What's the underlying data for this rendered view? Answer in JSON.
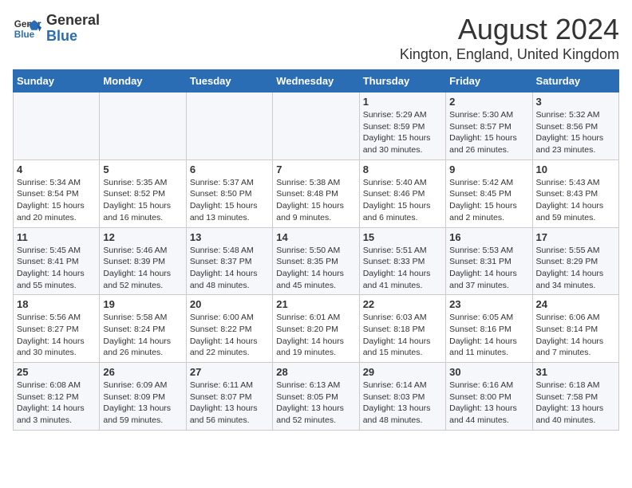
{
  "header": {
    "logo_line1": "General",
    "logo_line2": "Blue",
    "title": "August 2024",
    "subtitle": "Kington, England, United Kingdom"
  },
  "weekdays": [
    "Sunday",
    "Monday",
    "Tuesday",
    "Wednesday",
    "Thursday",
    "Friday",
    "Saturday"
  ],
  "weeks": [
    [
      {
        "day": "",
        "info": ""
      },
      {
        "day": "",
        "info": ""
      },
      {
        "day": "",
        "info": ""
      },
      {
        "day": "",
        "info": ""
      },
      {
        "day": "1",
        "info": "Sunrise: 5:29 AM\nSunset: 8:59 PM\nDaylight: 15 hours and 30 minutes."
      },
      {
        "day": "2",
        "info": "Sunrise: 5:30 AM\nSunset: 8:57 PM\nDaylight: 15 hours and 26 minutes."
      },
      {
        "day": "3",
        "info": "Sunrise: 5:32 AM\nSunset: 8:56 PM\nDaylight: 15 hours and 23 minutes."
      }
    ],
    [
      {
        "day": "4",
        "info": "Sunrise: 5:34 AM\nSunset: 8:54 PM\nDaylight: 15 hours and 20 minutes."
      },
      {
        "day": "5",
        "info": "Sunrise: 5:35 AM\nSunset: 8:52 PM\nDaylight: 15 hours and 16 minutes."
      },
      {
        "day": "6",
        "info": "Sunrise: 5:37 AM\nSunset: 8:50 PM\nDaylight: 15 hours and 13 minutes."
      },
      {
        "day": "7",
        "info": "Sunrise: 5:38 AM\nSunset: 8:48 PM\nDaylight: 15 hours and 9 minutes."
      },
      {
        "day": "8",
        "info": "Sunrise: 5:40 AM\nSunset: 8:46 PM\nDaylight: 15 hours and 6 minutes."
      },
      {
        "day": "9",
        "info": "Sunrise: 5:42 AM\nSunset: 8:45 PM\nDaylight: 15 hours and 2 minutes."
      },
      {
        "day": "10",
        "info": "Sunrise: 5:43 AM\nSunset: 8:43 PM\nDaylight: 14 hours and 59 minutes."
      }
    ],
    [
      {
        "day": "11",
        "info": "Sunrise: 5:45 AM\nSunset: 8:41 PM\nDaylight: 14 hours and 55 minutes."
      },
      {
        "day": "12",
        "info": "Sunrise: 5:46 AM\nSunset: 8:39 PM\nDaylight: 14 hours and 52 minutes."
      },
      {
        "day": "13",
        "info": "Sunrise: 5:48 AM\nSunset: 8:37 PM\nDaylight: 14 hours and 48 minutes."
      },
      {
        "day": "14",
        "info": "Sunrise: 5:50 AM\nSunset: 8:35 PM\nDaylight: 14 hours and 45 minutes."
      },
      {
        "day": "15",
        "info": "Sunrise: 5:51 AM\nSunset: 8:33 PM\nDaylight: 14 hours and 41 minutes."
      },
      {
        "day": "16",
        "info": "Sunrise: 5:53 AM\nSunset: 8:31 PM\nDaylight: 14 hours and 37 minutes."
      },
      {
        "day": "17",
        "info": "Sunrise: 5:55 AM\nSunset: 8:29 PM\nDaylight: 14 hours and 34 minutes."
      }
    ],
    [
      {
        "day": "18",
        "info": "Sunrise: 5:56 AM\nSunset: 8:27 PM\nDaylight: 14 hours and 30 minutes."
      },
      {
        "day": "19",
        "info": "Sunrise: 5:58 AM\nSunset: 8:24 PM\nDaylight: 14 hours and 26 minutes."
      },
      {
        "day": "20",
        "info": "Sunrise: 6:00 AM\nSunset: 8:22 PM\nDaylight: 14 hours and 22 minutes."
      },
      {
        "day": "21",
        "info": "Sunrise: 6:01 AM\nSunset: 8:20 PM\nDaylight: 14 hours and 19 minutes."
      },
      {
        "day": "22",
        "info": "Sunrise: 6:03 AM\nSunset: 8:18 PM\nDaylight: 14 hours and 15 minutes."
      },
      {
        "day": "23",
        "info": "Sunrise: 6:05 AM\nSunset: 8:16 PM\nDaylight: 14 hours and 11 minutes."
      },
      {
        "day": "24",
        "info": "Sunrise: 6:06 AM\nSunset: 8:14 PM\nDaylight: 14 hours and 7 minutes."
      }
    ],
    [
      {
        "day": "25",
        "info": "Sunrise: 6:08 AM\nSunset: 8:12 PM\nDaylight: 14 hours and 3 minutes."
      },
      {
        "day": "26",
        "info": "Sunrise: 6:09 AM\nSunset: 8:09 PM\nDaylight: 13 hours and 59 minutes."
      },
      {
        "day": "27",
        "info": "Sunrise: 6:11 AM\nSunset: 8:07 PM\nDaylight: 13 hours and 56 minutes."
      },
      {
        "day": "28",
        "info": "Sunrise: 6:13 AM\nSunset: 8:05 PM\nDaylight: 13 hours and 52 minutes."
      },
      {
        "day": "29",
        "info": "Sunrise: 6:14 AM\nSunset: 8:03 PM\nDaylight: 13 hours and 48 minutes."
      },
      {
        "day": "30",
        "info": "Sunrise: 6:16 AM\nSunset: 8:00 PM\nDaylight: 13 hours and 44 minutes."
      },
      {
        "day": "31",
        "info": "Sunrise: 6:18 AM\nSunset: 7:58 PM\nDaylight: 13 hours and 40 minutes."
      }
    ]
  ]
}
